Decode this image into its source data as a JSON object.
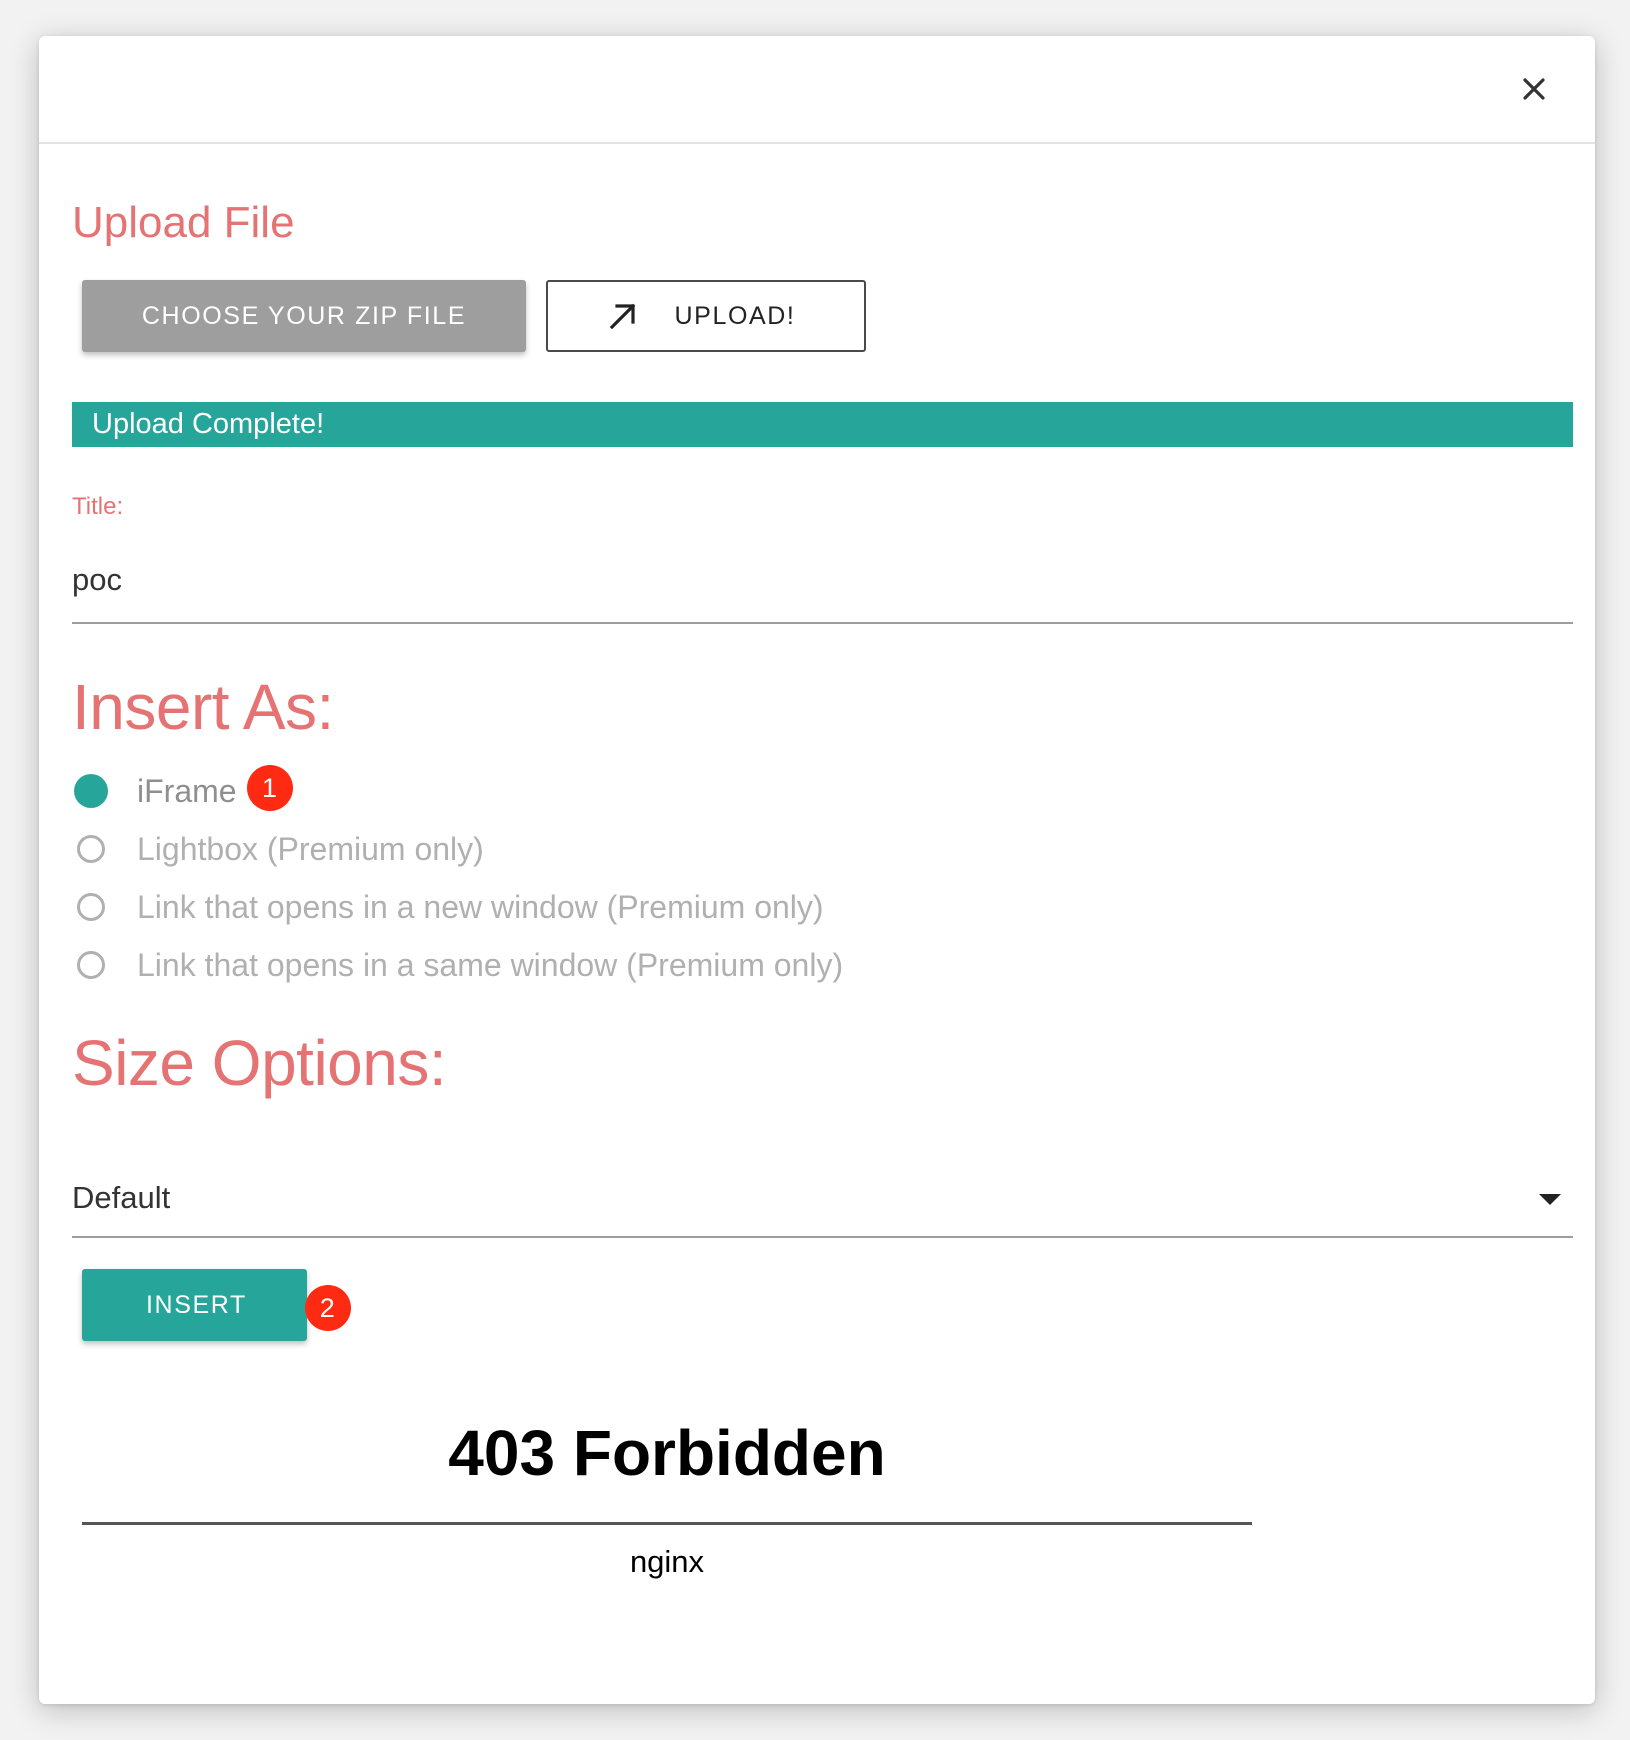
{
  "dialog": {
    "close_label": "×"
  },
  "upload": {
    "title": "Upload File",
    "choose_label": "CHOOSE YOUR ZIP FILE",
    "upload_label": "UPLOAD!",
    "progress_text": "Upload Complete!",
    "progress_percent": 100
  },
  "title_field": {
    "label": "Title:",
    "value": "poc"
  },
  "insert_as": {
    "title": "Insert As:",
    "options": [
      {
        "label": "iFrame",
        "checked": true,
        "badge": "1"
      },
      {
        "label": "Lightbox (Premium only)",
        "checked": false
      },
      {
        "label": "Link that opens in a new window (Premium only)",
        "checked": false
      },
      {
        "label": "Link that opens in a same window (Premium only)",
        "checked": false
      }
    ]
  },
  "size_options": {
    "title": "Size Options:",
    "selected": "Default"
  },
  "insert_button": {
    "label": "INSERT",
    "badge": "2"
  },
  "frame": {
    "heading": "403 Forbidden",
    "server": "nginx"
  },
  "colors": {
    "accent": "#e57373",
    "primary": "#26a69a",
    "badge": "#ff2a12"
  },
  "icons": {
    "close": "close-icon",
    "upload": "arrow-up-right-icon",
    "dropdown": "caret-down-icon"
  }
}
